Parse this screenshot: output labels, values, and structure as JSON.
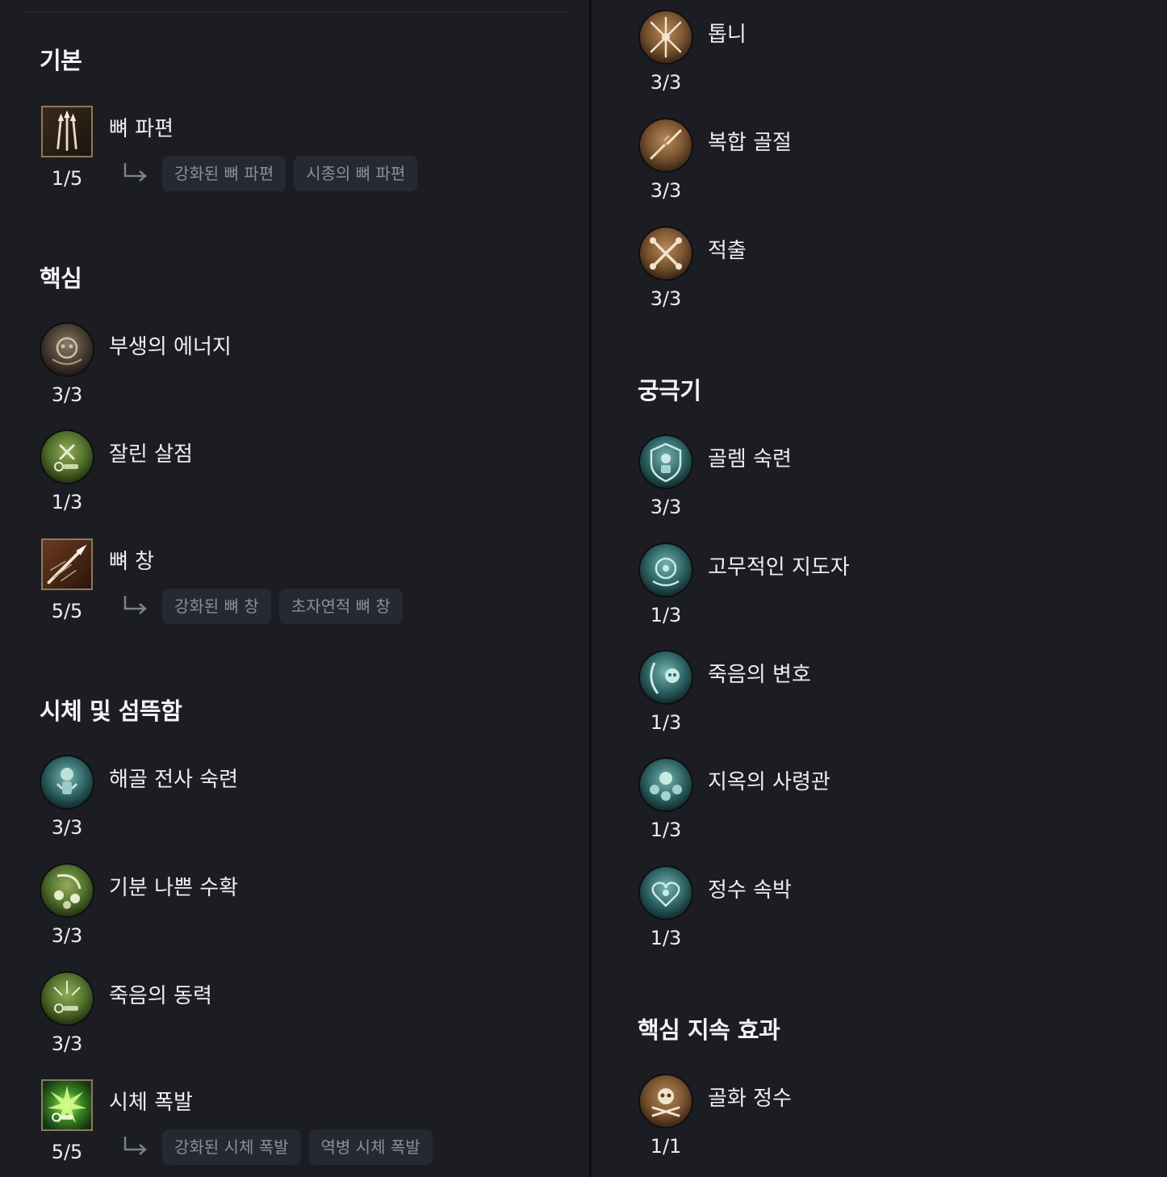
{
  "sections": {
    "basic": {
      "title": "기본"
    },
    "core": {
      "title": "핵심"
    },
    "corpse": {
      "title": "시체 및 섬뜩함"
    },
    "ultimate": {
      "title": "궁극기"
    },
    "key_passive": {
      "title": "핵심 지속 효과"
    }
  },
  "skills": {
    "bone_splinters": {
      "name": "뼈 파편",
      "points": "1/5",
      "enh1": "강화된 뼈 파편",
      "enh2": "시종의 뼈 파편",
      "icon": "bone-splinters-icon"
    },
    "unliving_energy": {
      "name": "부생의 에너지",
      "points": "3/3",
      "icon": "skull-orb-icon"
    },
    "hewed_flesh": {
      "name": "잘린 살점",
      "points": "1/3",
      "icon": "flesh-icon"
    },
    "bone_spear": {
      "name": "뼈 창",
      "points": "5/5",
      "enh1": "강화된 뼈 창",
      "enh2": "초자연적 뼈 창",
      "icon": "bone-spear-icon"
    },
    "skeletal_warrior": {
      "name": "해골 전사 숙련",
      "points": "3/3",
      "icon": "skeleton-warrior-icon"
    },
    "grim_harvest": {
      "name": "기분 나쁜 수확",
      "points": "3/3",
      "icon": "scythe-skulls-icon"
    },
    "fueled_by_death": {
      "name": "죽음의 동력",
      "points": "3/3",
      "icon": "death-power-icon"
    },
    "corpse_explosion": {
      "name": "시체 폭발",
      "points": "5/5",
      "enh1": "강화된 시체 폭발",
      "enh2": "역병 시체 폭발",
      "icon": "corpse-explosion-icon"
    },
    "serration": {
      "name": "톱니",
      "points": "3/3",
      "icon": "serrated-bones-icon"
    },
    "compound_fracture": {
      "name": "복합 골절",
      "points": "3/3",
      "icon": "fracture-icon"
    },
    "evulsion": {
      "name": "적출",
      "points": "3/3",
      "icon": "crossed-bones-icon"
    },
    "golem_mastery": {
      "name": "골렘 숙련",
      "points": "3/3",
      "icon": "golem-shield-icon"
    },
    "inspiring_leader": {
      "name": "고무적인 지도자",
      "points": "1/3",
      "icon": "leader-icon"
    },
    "death_defense": {
      "name": "죽음의 변호",
      "points": "1/3",
      "icon": "scythe-skull-icon"
    },
    "hellbent_commander": {
      "name": "지옥의 사령관",
      "points": "1/3",
      "icon": "skull-army-icon"
    },
    "essence_bind": {
      "name": "정수 속박",
      "points": "1/3",
      "icon": "essence-heart-icon"
    },
    "ossified_essence": {
      "name": "골화 정수",
      "points": "1/1",
      "icon": "ossified-skull-icon"
    }
  },
  "colors": {
    "background": "#1b1d23",
    "chip_bg": "#262932",
    "chip_text": "#8a8f99",
    "bone": "#6b4a2b",
    "flesh": "#4d6a2c",
    "minion": "#2a5e5e"
  }
}
